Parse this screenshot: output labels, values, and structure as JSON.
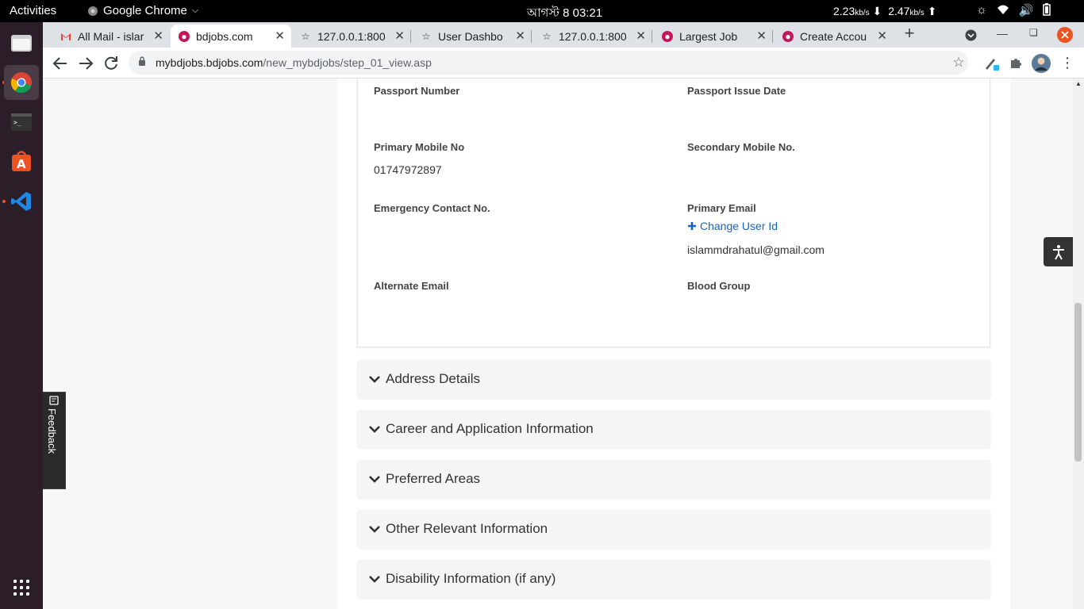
{
  "system": {
    "activities": "Activities",
    "app_menu": "Google Chrome",
    "clock": "আগস্ট 8  03:21",
    "net_down": "2.23",
    "net_up": "2.47",
    "net_unit": "kb/s"
  },
  "tabs": [
    {
      "title": "All Mail - islar",
      "icon": "gmail-icon"
    },
    {
      "title": "bdjobs.com",
      "icon": "bdjobs-icon",
      "active": true
    },
    {
      "title": "127.0.0.1:800",
      "icon": "star-icon"
    },
    {
      "title": "User Dashbo",
      "icon": "star-icon"
    },
    {
      "title": "127.0.0.1:800",
      "icon": "star-icon"
    },
    {
      "title": "Largest Job",
      "icon": "bdjobs-icon"
    },
    {
      "title": "Create Accou",
      "icon": "bdjobs-icon"
    }
  ],
  "address_bar": {
    "host": "mybdjobs.bdjobs.com",
    "path": "/new_mybdjobs/step_01_view.asp"
  },
  "fields": {
    "passport_number_label": "Passport Number",
    "passport_issue_date_label": "Passport Issue Date",
    "primary_mobile_label": "Primary Mobile No",
    "primary_mobile_value": "01747972897",
    "secondary_mobile_label": "Secondary Mobile No.",
    "emergency_contact_label": "Emergency Contact No.",
    "primary_email_label": "Primary Email",
    "change_user_id": "Change User Id",
    "primary_email_value": "islammdrahatul@gmail.com",
    "alternate_email_label": "Alternate Email",
    "blood_group_label": "Blood Group"
  },
  "sections": [
    "Address Details",
    "Career and Application Information",
    "Preferred Areas",
    "Other Relevant Information",
    "Disability Information (if any)"
  ],
  "feedback": "Feedback",
  "colors": {
    "link": "#1565c0",
    "brand": "#c2185b",
    "dock": "#2c1e29"
  }
}
